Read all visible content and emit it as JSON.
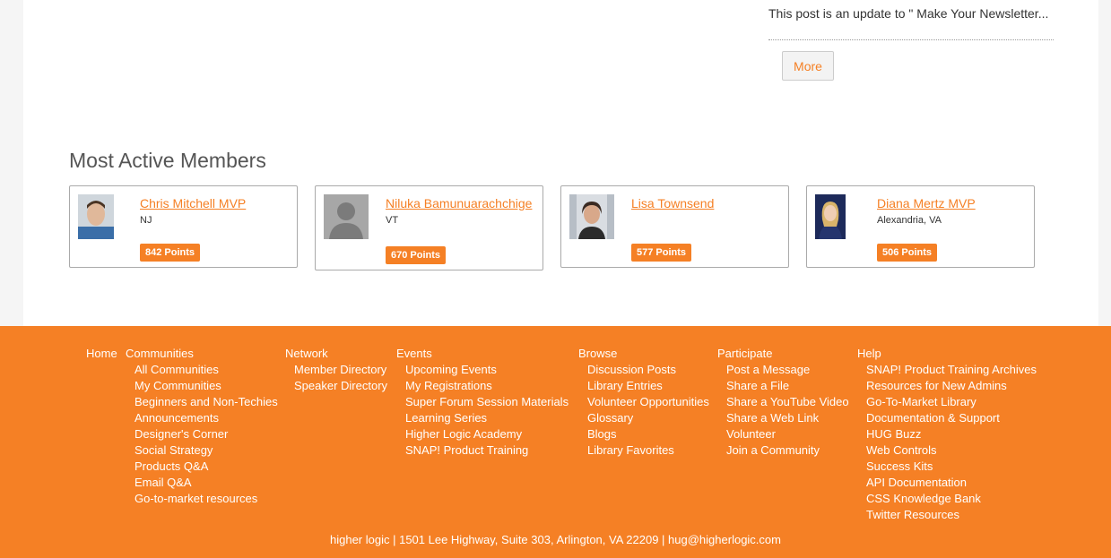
{
  "post": {
    "excerpt": "This post is an update to \" Make Your Newsletter...",
    "more_label": "More"
  },
  "most_active": {
    "title": "Most Active Members",
    "members": [
      {
        "name": "Chris Mitchell MVP",
        "location": "NJ",
        "points": "842 Points"
      },
      {
        "name": "Niluka Bamunuarachchige",
        "location": "VT",
        "points": "670 Points"
      },
      {
        "name": "Lisa Townsend",
        "location": "",
        "points": "577 Points"
      },
      {
        "name": "Diana Mertz MVP",
        "location": "Alexandria, VA",
        "points": "506 Points"
      }
    ]
  },
  "footer": {
    "home": "Home",
    "communities": {
      "label": "Communities",
      "items": [
        "All Communities",
        "My Communities",
        "Beginners and Non-Techies",
        "Announcements",
        "Designer's Corner",
        "Social Strategy",
        "Products Q&A",
        "Email Q&A",
        "Go-to-market resources"
      ]
    },
    "network": {
      "label": "Network",
      "items": [
        "Member Directory",
        "Speaker Directory"
      ]
    },
    "events": {
      "label": "Events",
      "items": [
        "Upcoming Events",
        "My Registrations",
        "Super Forum Session Materials",
        "Learning Series",
        "Higher Logic Academy",
        "SNAP! Product Training"
      ]
    },
    "browse": {
      "label": "Browse",
      "items": [
        "Discussion Posts",
        "Library Entries",
        "Volunteer Opportunities",
        "Glossary",
        "Blogs",
        "Library Favorites"
      ]
    },
    "participate": {
      "label": "Participate",
      "items": [
        "Post a Message",
        "Share a File",
        "Share a YouTube Video",
        "Share a Web Link",
        "Volunteer",
        "Join a Community"
      ]
    },
    "help": {
      "label": "Help",
      "items": [
        "SNAP! Product Training Archives",
        "Resources for New Admins",
        "Go-To-Market Library",
        "Documentation & Support",
        "HUG Buzz",
        "Web Controls",
        "Success Kits",
        "API Documentation",
        "CSS Knowledge Bank",
        "Twitter Resources"
      ]
    },
    "address": "higher logic | 1501 Lee Highway, Suite 303, Arlington, VA 22209 |",
    "email": "hug@higherlogic.com"
  },
  "colors": {
    "accent": "#f58025",
    "footer_bg": "#f58025"
  }
}
